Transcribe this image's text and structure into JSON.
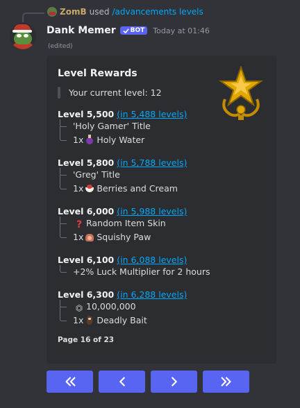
{
  "reply": {
    "user": "ZomB",
    "used_text": "used",
    "command": "/advancements levels"
  },
  "message": {
    "author": "Dank Memer",
    "bot_badge": "BOT",
    "timestamp": "Today at 01:46",
    "edited": "(edited)"
  },
  "embed": {
    "title": "Level Rewards",
    "current_level": "Your current level: 12",
    "tiers": [
      {
        "level": "Level 5,500",
        "eta": "(in 5,488 levels)",
        "items": [
          {
            "prefix": "",
            "icon": "",
            "text": "'Holy Gamer' Title"
          },
          {
            "prefix": "1x",
            "icon": "holy-water-icon",
            "text": "Holy Water"
          }
        ]
      },
      {
        "level": "Level 5,800",
        "eta": "(in 5,788 levels)",
        "items": [
          {
            "prefix": "",
            "icon": "",
            "text": "'Greg' Title"
          },
          {
            "prefix": "1x",
            "icon": "berries-and-cream-icon",
            "text": "Berries and Cream"
          }
        ]
      },
      {
        "level": "Level 6,000",
        "eta": "(in 5,988 levels)",
        "items": [
          {
            "prefix": "",
            "icon": "question-mark-icon",
            "text": "Random Item Skin"
          },
          {
            "prefix": "1x",
            "icon": "squishy-paw-icon",
            "text": "Squishy Paw"
          }
        ]
      },
      {
        "level": "Level 6,100",
        "eta": "(in 6,088 levels)",
        "items": [
          {
            "prefix": "",
            "icon": "",
            "text": "+2% Luck Multiplier for 2 hours"
          }
        ]
      },
      {
        "level": "Level 6,300",
        "eta": "(in 6,288 levels)",
        "items": [
          {
            "prefix": "",
            "icon": "coin-icon",
            "text": "10,000,000"
          },
          {
            "prefix": "1x",
            "icon": "deadly-bait-icon",
            "text": "Deadly Bait"
          }
        ]
      }
    ],
    "footer": "Page 16 of 23"
  },
  "buttons": [
    {
      "name": "first-page-button",
      "icon": "double-chevron-left-icon"
    },
    {
      "name": "previous-page-button",
      "icon": "chevron-left-icon"
    },
    {
      "name": "next-page-button",
      "icon": "chevron-right-icon"
    },
    {
      "name": "last-page-button",
      "icon": "double-chevron-right-icon"
    }
  ],
  "colors": {
    "background": "#313338",
    "embed": "#2b2d31",
    "link": "#00a8fc",
    "button": "#5865f2",
    "star": "#e0a800"
  }
}
